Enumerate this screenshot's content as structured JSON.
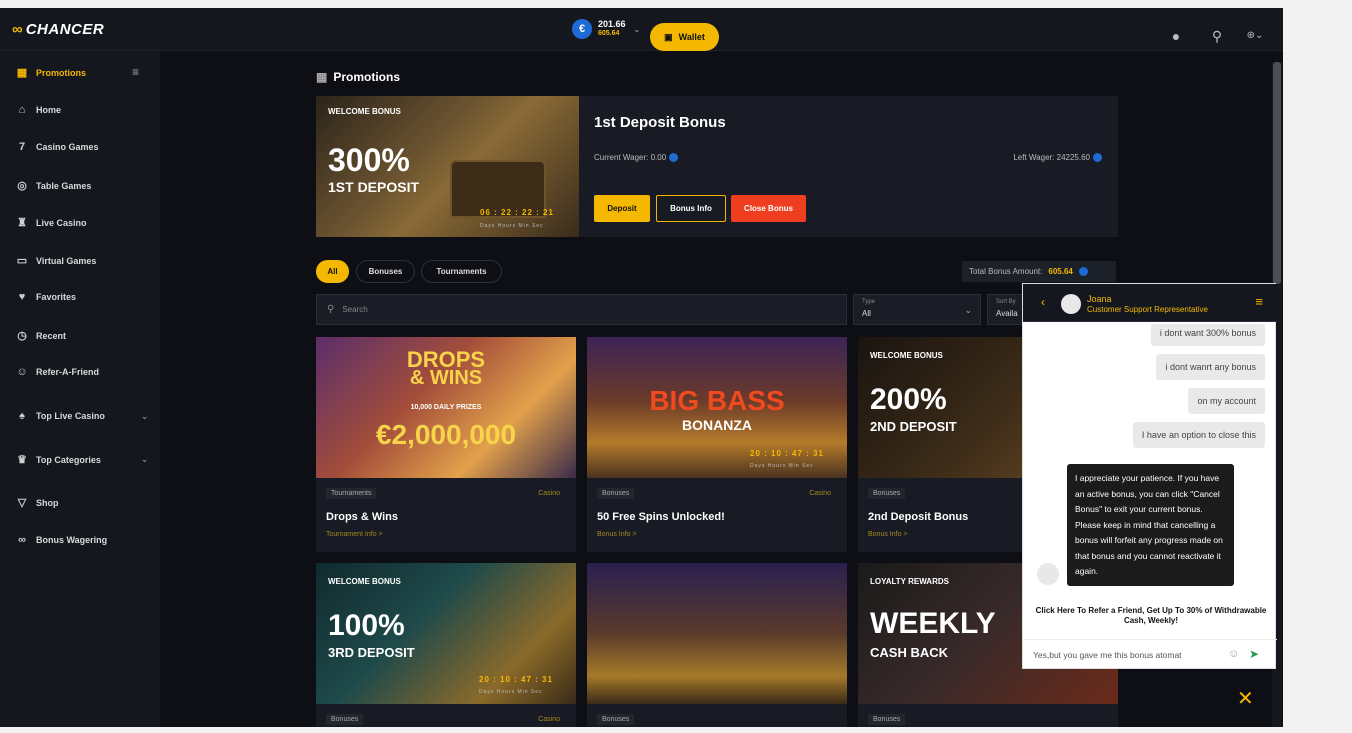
{
  "header": {
    "logo": "CHANCER",
    "balance": "201.66",
    "bonus_balance": "605.64",
    "wallet_label": "Wallet",
    "currency_symbol": "€"
  },
  "sidebar": {
    "items": [
      {
        "label": "Promotions",
        "icon": "gift-icon"
      },
      {
        "label": "Home",
        "icon": "home-icon"
      },
      {
        "label": "Casino Games",
        "icon": "seven-icon"
      },
      {
        "label": "Table Games",
        "icon": "chip-icon"
      },
      {
        "label": "Live Casino",
        "icon": "chess-icon"
      },
      {
        "label": "Virtual Games",
        "icon": "gamepad-icon"
      },
      {
        "label": "Favorites",
        "icon": "shield-heart-icon"
      },
      {
        "label": "Recent",
        "icon": "clock-icon"
      },
      {
        "label": "Refer-A-Friend",
        "icon": "users-icon"
      },
      {
        "label": "Top Live Casino",
        "icon": "cards-icon"
      },
      {
        "label": "Top Categories",
        "icon": "crown-icon"
      },
      {
        "label": "Shop",
        "icon": "cart-icon"
      },
      {
        "label": "Bonus Wagering",
        "icon": "link-icon"
      }
    ]
  },
  "page": {
    "title": "Promotions"
  },
  "hero": {
    "tag": "WELCOME BONUS",
    "pct": "300%",
    "sub": "1ST DEPOSIT",
    "timer": "06 : 22 : 22 : 21",
    "timer_labels": "Days Hours Min Sec",
    "name": "1st Deposit Bonus",
    "current_wager": "Current Wager: 0.00",
    "left_wager": "Left Wager: 24225.60",
    "btn_deposit": "Deposit",
    "btn_info": "Bonus Info",
    "btn_close": "Close Bonus"
  },
  "filters": {
    "chips": [
      "All",
      "Bonuses",
      "Tournaments"
    ],
    "total_label": "Total Bonus Amount:",
    "total_value": "605.64"
  },
  "search": {
    "placeholder": "Search"
  },
  "type_select": {
    "label": "Type",
    "value": "All"
  },
  "sort_select": {
    "label": "Sort By",
    "value": "Availa"
  },
  "cards": [
    {
      "category": "Tournaments",
      "provider": "Casino",
      "title": "Drops & Wins",
      "link": "Tournament Info >",
      "banner_top": "DROPS",
      "banner_mid": "& WINS",
      "banner_prize": "10,000 DAILY PRIZES",
      "banner_amount": "€2,000,000"
    },
    {
      "category": "Bonuses",
      "provider": "Casino",
      "title": "50 Free Spins Unlocked!",
      "link": "Bonus Info >",
      "banner_top": "BIG BASS",
      "banner_mid": "BONANZA",
      "timer": "20 : 10 : 47 : 31",
      "timer_labels": "Days Hours Min Sec"
    },
    {
      "category": "Bonuses",
      "title": "2nd Deposit Bonus",
      "link": "Bonus Info >",
      "tag": "WELCOME BONUS",
      "pct": "200%",
      "sub": "2ND DEPOSIT"
    },
    {
      "category": "Bonuses",
      "provider": "Casino",
      "tag": "WELCOME BONUS",
      "pct": "100%",
      "sub": "3RD DEPOSIT",
      "timer": "20 : 10 : 47 : 31",
      "timer_labels": "Days Hours Min Sec"
    },
    {
      "category": "Bonuses"
    },
    {
      "category": "Bonuses",
      "tag": "LOYALTY REWARDS",
      "pct": "WEEKLY",
      "sub": "CASH BACK"
    }
  ],
  "chat": {
    "agent_name": "Joana",
    "agent_role": "Customer Support Representative",
    "messages": [
      "i dont want 300% bonus",
      "i dont wanrt any bonus",
      "on my account",
      "I have an option to close this"
    ],
    "agent_reply": "I appreciate your patience. If you have an active bonus, you can click \"Cancel Bonus\" to exit your current bonus. Please keep in mind that cancelling a bonus will forfeit any progress made on that bonus and you cannot reactivate it again.",
    "refer_text": "Click Here To Refer a Friend, Get Up To 30% of Withdrawable Cash, Weekly!",
    "input_text": "Yes,but you gave me this bonus atomat"
  },
  "colors": {
    "accent": "#f5b800",
    "danger": "#ee3e1f",
    "bg": "#0d0f14",
    "panel": "#14171e",
    "euro": "#1e6bd6"
  }
}
